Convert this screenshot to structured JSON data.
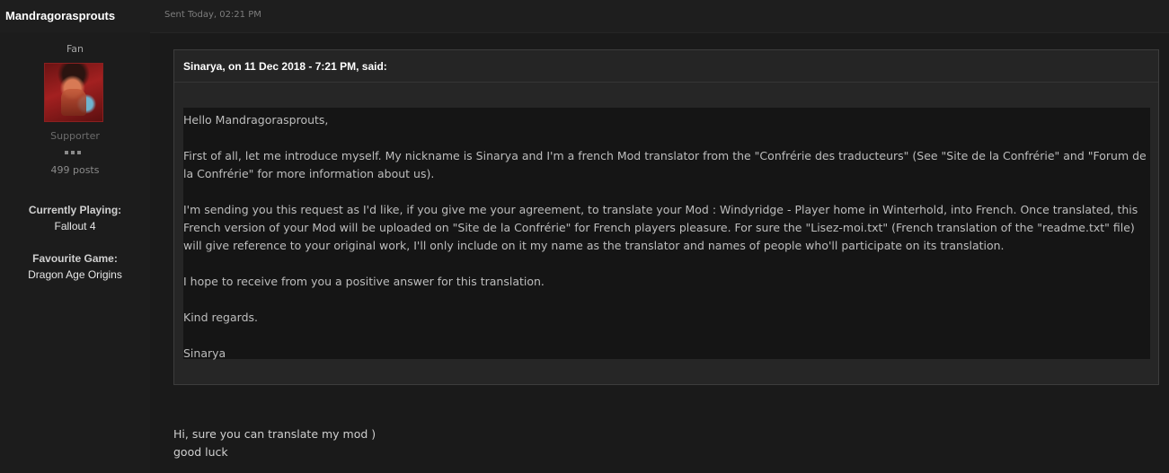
{
  "post": {
    "author": "Mandragorasprouts",
    "date": "Sent Today, 02:21 PM"
  },
  "author_info": {
    "group": "Fan",
    "avatar_icon": "member-avatar-warrior",
    "title": "Supporter",
    "pips": 3,
    "posts": "499 posts",
    "fields": [
      {
        "label": "Currently Playing:",
        "value": "Fallout 4"
      },
      {
        "label": "Favourite Game:",
        "value": "Dragon Age Origins"
      }
    ]
  },
  "quote": {
    "citation": "Sinarya, on 11 Dec 2018 - 7:21 PM, said:",
    "lines": [
      "Hello Mandragorasprouts,",
      "",
      "First of all, let me introduce myself. My nickname is Sinarya and I'm a french Mod translator from the \"Confrérie des traducteurs\" (See \"Site de la Confrérie\" and \"Forum de",
      "la Confrérie\" for more information about us).",
      "",
      "I'm sending you this request as I'd like, if you give me your agreement, to translate your Mod : Windyridge - Player home in Winterhold, into French. Once translated, this",
      "French version of your Mod will be uploaded on \"Site de la Confrérie\" for French players pleasure. For sure the \"Lisez-moi.txt\" (French translation of the \"readme.txt\" file)",
      "will give reference to your original work, I'll only include on it my name as the translator and names of people who'll participate on its translation.",
      "",
      "I hope to receive from you a positive answer for this translation.",
      "",
      "Kind regards.",
      "",
      "Sinarya"
    ]
  },
  "reply": {
    "lines": [
      "Hi, sure you can translate my mod )",
      "good luck"
    ]
  },
  "colors": {
    "background": "#1a1a1a",
    "quote_bg": "#151515",
    "text": "#bdbdbd"
  }
}
